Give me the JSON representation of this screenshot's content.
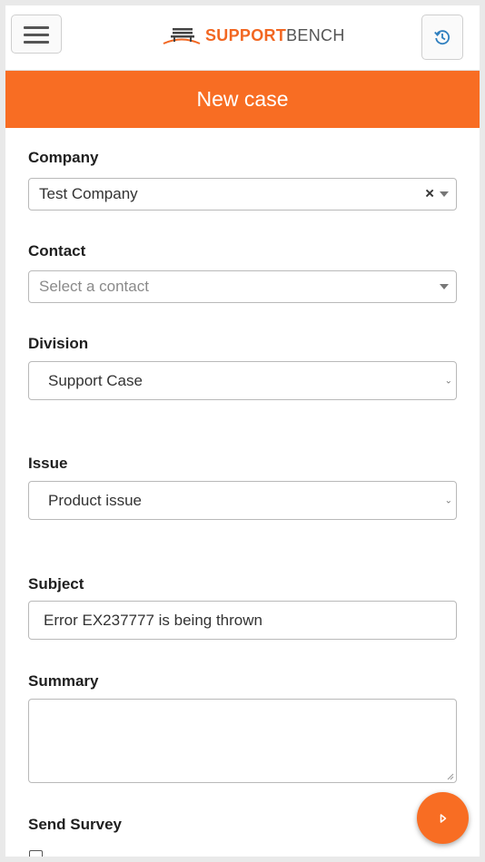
{
  "header": {
    "brand_primary": "SUPPORT",
    "brand_secondary": "BENCH",
    "menu_icon": "hamburger-icon",
    "history_icon": "history-icon"
  },
  "page": {
    "title": "New case"
  },
  "form": {
    "company": {
      "label": "Company",
      "value": "Test Company",
      "clear": "×"
    },
    "contact": {
      "label": "Contact",
      "placeholder": "Select a contact"
    },
    "division": {
      "label": "Division",
      "value": "Support Case"
    },
    "issue": {
      "label": "Issue",
      "value": "Product issue"
    },
    "subject": {
      "label": "Subject",
      "value": "Error EX237777 is being thrown"
    },
    "summary": {
      "label": "Summary",
      "value": ""
    },
    "send_survey": {
      "label": "Send Survey",
      "checked": false
    }
  },
  "colors": {
    "accent": "#f86d23",
    "brand_orange": "#f26722",
    "history_blue": "#2f7fbf"
  }
}
